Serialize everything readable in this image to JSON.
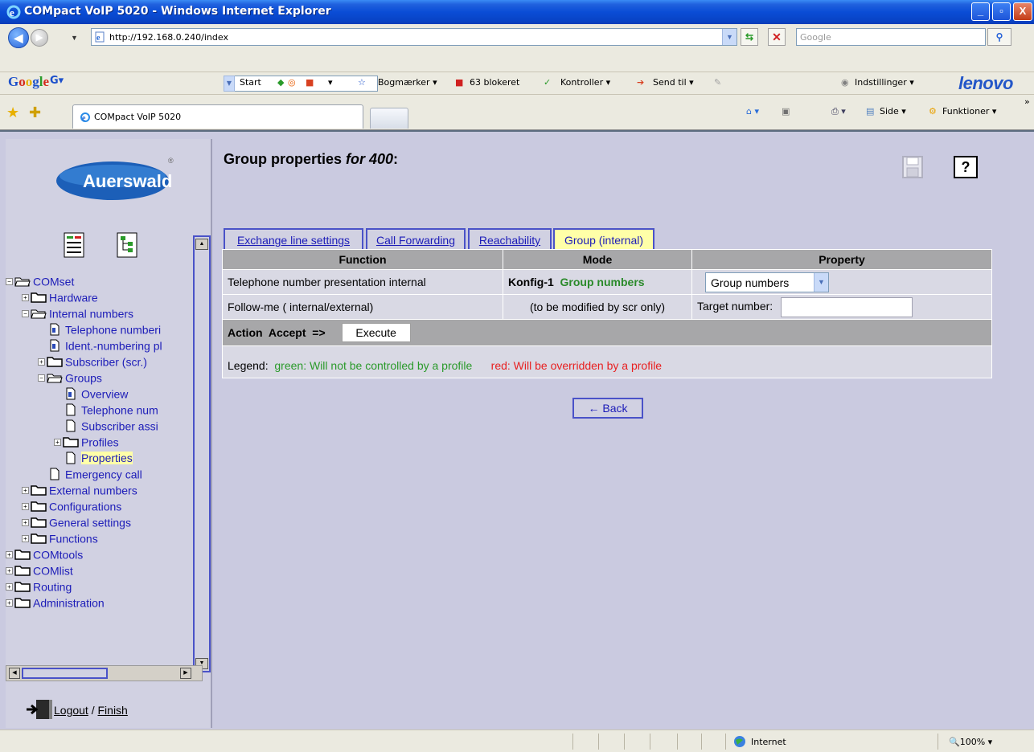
{
  "window": {
    "title": "COMpact VoIP 5020 - Windows Internet Explorer",
    "minimize": "_",
    "restore": "▫",
    "close": "X"
  },
  "addressbar": {
    "url": "http://192.168.0.240/index",
    "search_placeholder": "Google"
  },
  "googlebar": {
    "logo_g": "G",
    "logo_o1": "o",
    "logo_o2": "o",
    "logo_g2": "g",
    "logo_l": "l",
    "logo_e": "e",
    "g_button": "G▾",
    "start": "Start",
    "bookmarks": "Bogmærker ▾",
    "blocked": "63 blokeret",
    "check": "Kontroller ▾",
    "sendto": "Send til ▾",
    "settings": "Indstillinger ▾",
    "brand": "lenovo"
  },
  "tabs_bar": {
    "active_tab": "COMpact VoIP 5020",
    "page": "Side ▾",
    "functions": "Funktioner ▾"
  },
  "sidebar": {
    "logo_text": "Auerswald",
    "tree": [
      {
        "label": "COMset",
        "level": 0
      },
      {
        "label": "Hardware",
        "level": 1
      },
      {
        "label": "Internal numbers",
        "level": 1
      },
      {
        "label": "Telephone numberi",
        "level": 2
      },
      {
        "label": "Ident.-numbering pl",
        "level": 2
      },
      {
        "label": "Subscriber (scr.)",
        "level": 2
      },
      {
        "label": "Groups",
        "level": 2
      },
      {
        "label": "Overview",
        "level": 3
      },
      {
        "label": "Telephone num",
        "level": 3
      },
      {
        "label": "Subscriber assi",
        "level": 3
      },
      {
        "label": "Profiles",
        "level": 3
      },
      {
        "label": "Properties",
        "level": 3
      },
      {
        "label": "Emergency call",
        "level": 2
      },
      {
        "label": "External numbers",
        "level": 1
      },
      {
        "label": "Configurations",
        "level": 1
      },
      {
        "label": "General settings",
        "level": 1
      },
      {
        "label": "Functions",
        "level": 1
      },
      {
        "label": "COMtools",
        "level": 0
      },
      {
        "label": "COMlist",
        "level": 0
      },
      {
        "label": "Routing",
        "level": 0
      },
      {
        "label": "Administration",
        "level": 0
      }
    ],
    "logout": "Logout",
    "slash": " / ",
    "finish": "Finish"
  },
  "main": {
    "title_prefix": "Group properties ",
    "title_for": "for 400",
    "title_suffix": ":",
    "help": "?",
    "tabs": [
      "Exchange line settings",
      "Call Forwarding",
      "Reachability",
      "Group (internal)"
    ],
    "headers": {
      "function": "Function",
      "mode": "Mode",
      "property": "Property"
    },
    "rows": [
      {
        "function": "Telephone number presentation internal",
        "mode_prefix": "Konfig-1",
        "mode_value": "Group numbers",
        "property_select": "Group numbers"
      },
      {
        "function": "Follow-me ( internal/external)",
        "mode_text": "(to be modified by scr only)",
        "property_label": "Target number:",
        "property_input": ""
      }
    ],
    "action": {
      "label": "Action",
      "value": "Accept",
      "arrow": "=>",
      "button": "Execute"
    },
    "legend": {
      "label": "Legend:",
      "green": "green: Will not be controlled by a profile",
      "red": "red: Will be overridden by a profile"
    },
    "back": "← Back"
  },
  "statusbar": {
    "zone": "Internet",
    "zoom": "100%"
  },
  "colors": {
    "highlight_yellow": "#FFFFA8",
    "link_blue": "#1C1CB8",
    "green": "#2A9A2A",
    "red": "#E82020"
  }
}
